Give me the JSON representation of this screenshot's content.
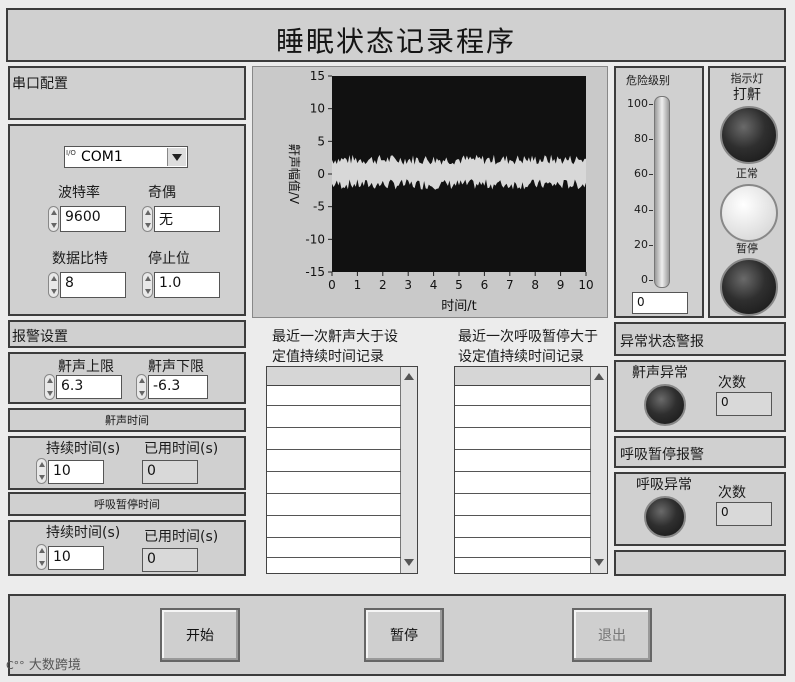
{
  "window": {
    "title": "睡眠状态记录程序"
  },
  "serial": {
    "section_title": "串口配置",
    "port_prefix": "I/O",
    "port_value": "COM1",
    "baud_label": "波特率",
    "baud_value": "9600",
    "parity_label": "奇偶",
    "parity_value": "无",
    "databits_label": "数据比特",
    "databits_value": "8",
    "stopbits_label": "停止位",
    "stopbits_value": "1.0"
  },
  "alarm": {
    "section_title": "报警设置",
    "upper_label": "鼾声上限",
    "upper_value": "6.3",
    "lower_label": "鼾声下限",
    "lower_value": "-6.3",
    "snore_time_title": "鼾声时间",
    "snore_duration_label": "持续时间(s)",
    "snore_duration_value": "10",
    "snore_used_label": "已用时间(s)",
    "snore_used_value": "0",
    "apnea_time_title": "呼吸暂停时间",
    "apnea_duration_label": "持续时间(s)",
    "apnea_duration_value": "10",
    "apnea_used_label": "已用时间(s)",
    "apnea_used_value": "0"
  },
  "chart_data": {
    "type": "line",
    "title": "",
    "xlabel": "时间/t",
    "ylabel": "鼾声幅值/V",
    "xlim": [
      0,
      10
    ],
    "ylim": [
      -15,
      15
    ],
    "xticks": [
      "0",
      "1",
      "2",
      "3",
      "4",
      "5",
      "6",
      "7",
      "8",
      "9",
      "10"
    ],
    "yticks": [
      "15",
      "10",
      "5",
      "0",
      "-5",
      "-10",
      "-15"
    ],
    "grid": false,
    "series": [
      {
        "name": "",
        "band_upper": 2.2,
        "band_lower": -1.6,
        "noise": 0.8
      }
    ]
  },
  "logs": {
    "snore_title": "最近一次鼾声大于设定值持续时间记录",
    "snore_title_l1": "最近一次鼾声大于设",
    "snore_title_l2": "定值持续时间记录",
    "apnea_title_l1": "最近一次呼吸暂停大于",
    "apnea_title_l2": "设定值持续时间记录"
  },
  "danger": {
    "label": "危险级别",
    "ticks": [
      "100",
      "80",
      "60",
      "40",
      "20",
      "0"
    ],
    "value": "0",
    "level": 0
  },
  "indicator": {
    "label_l1": "指示灯",
    "label_l2": "打鼾",
    "normal_label": "正常",
    "pause_label": "暂停"
  },
  "abnormal": {
    "section_title": "异常状态警报",
    "snore_abn_label": "鼾声异常",
    "snore_count_label": "次数",
    "snore_count_value": "0",
    "apnea_section_title": "呼吸暂停报警",
    "apnea_abn_label": "呼吸异常",
    "apnea_count_label": "次数",
    "apnea_count_value": "0"
  },
  "controls": {
    "start": "开始",
    "pause": "暂停",
    "exit": "退出"
  },
  "watermark": {
    "text": "大数跨境"
  },
  "colors": {
    "panel_bg": "#d0d0d0",
    "graph_bg": "#111111",
    "signal": "#d8d8d8"
  }
}
